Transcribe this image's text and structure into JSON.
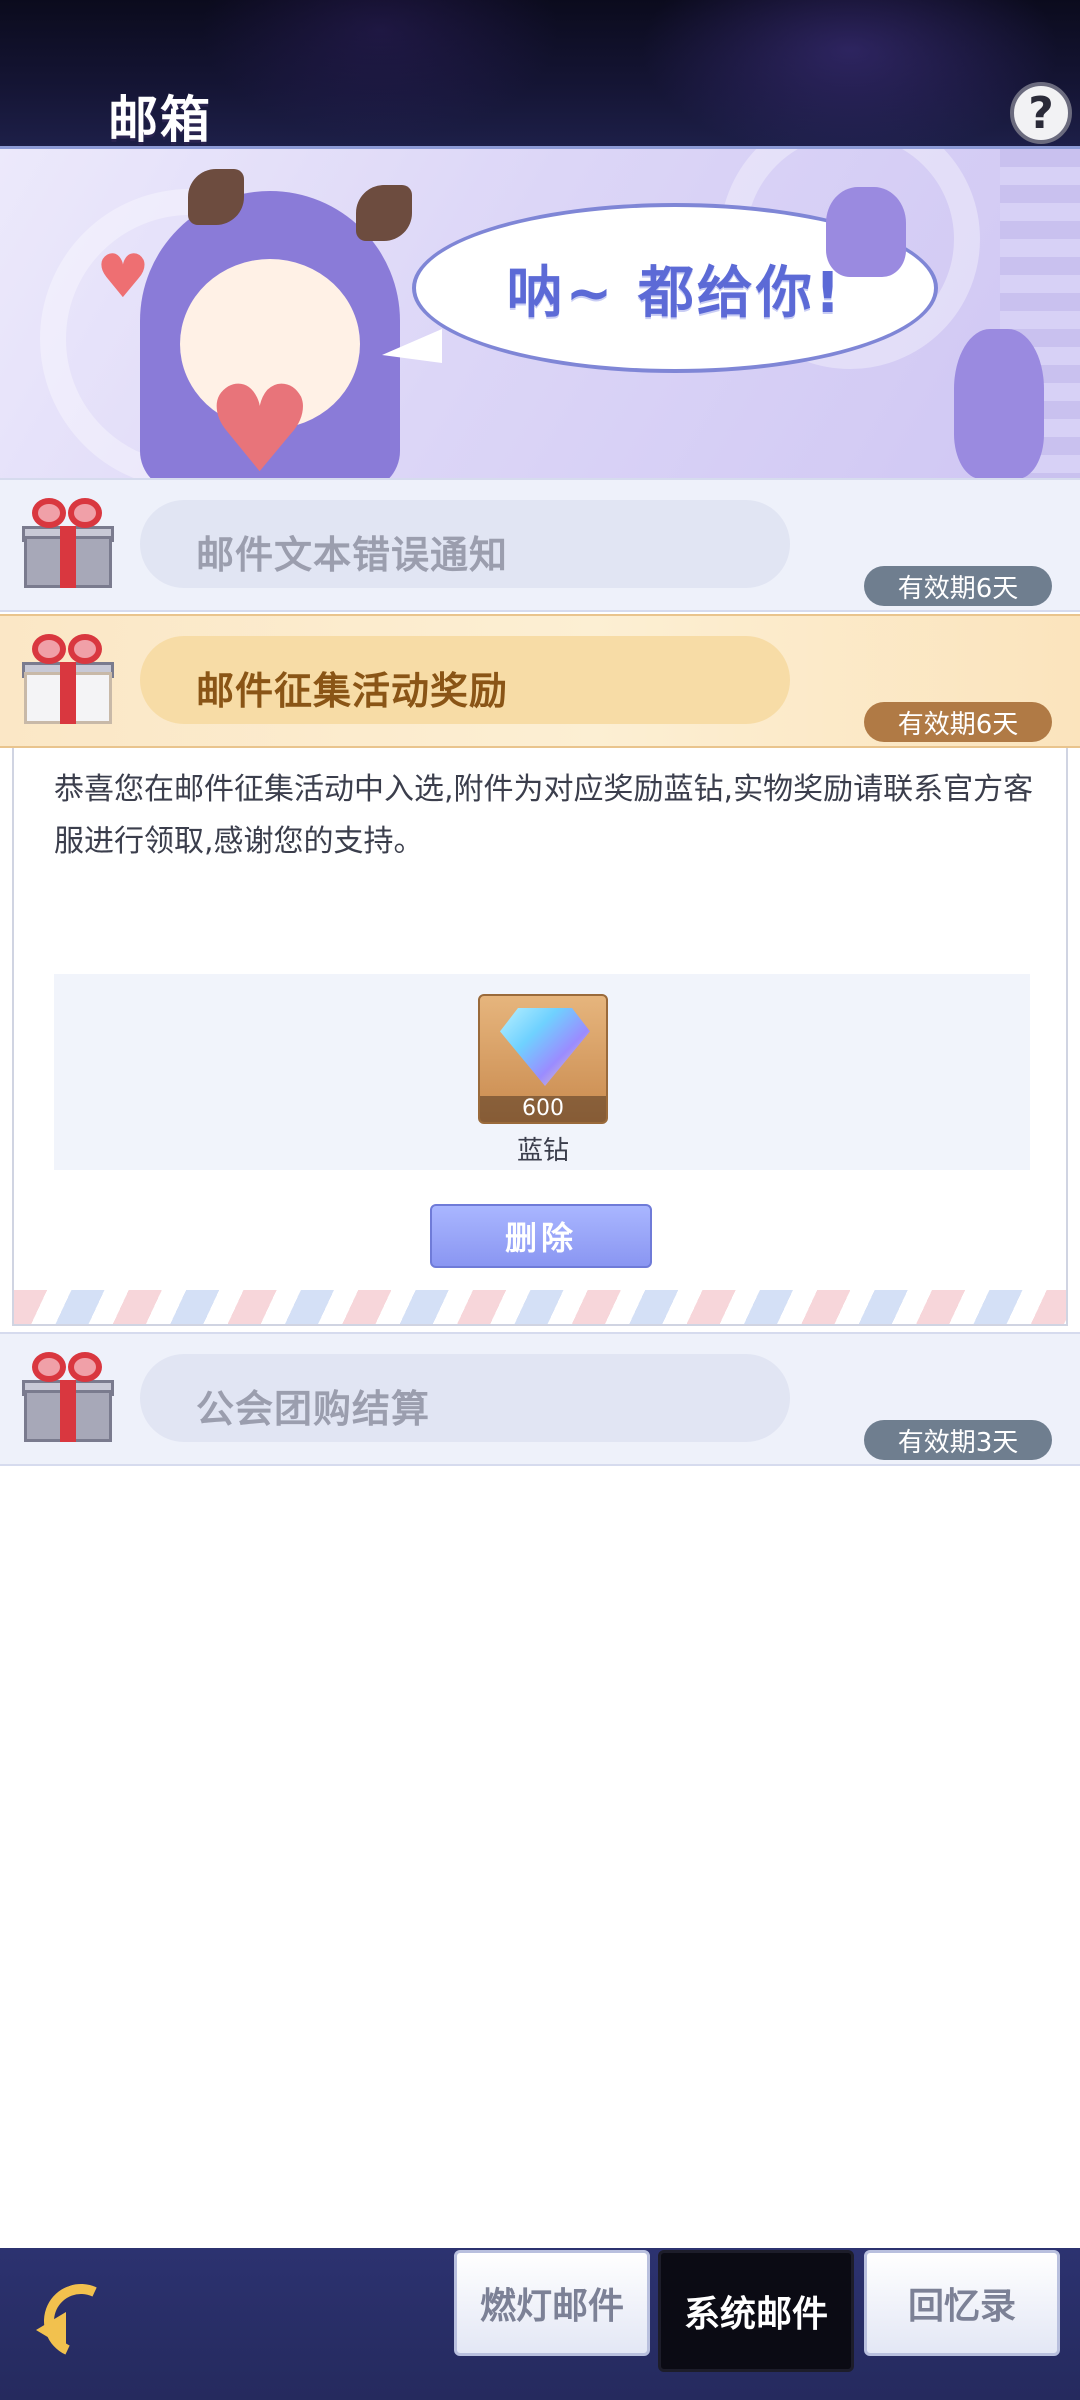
{
  "header": {
    "title": "邮箱",
    "help_label": "?"
  },
  "banner": {
    "speech": "呐~ 都给你!"
  },
  "mails": [
    {
      "title": "邮件文本错误通知",
      "validity": "有效期6天",
      "expanded": false
    },
    {
      "title": "邮件征集活动奖励",
      "validity": "有效期6天",
      "expanded": true
    },
    {
      "title": "公会团购结算",
      "validity": "有效期3天",
      "expanded": false
    }
  ],
  "expanded_mail": {
    "body": "恭喜您在邮件征集活动中入选,附件为对应奖励蓝钻,实物奖励请联系官方客服进行领取,感谢您的支持。",
    "attachment": {
      "icon": "blue-diamond-icon",
      "count": "600",
      "name": "蓝钻"
    },
    "delete_label": "删除"
  },
  "tabs": [
    {
      "label": "燃灯邮件",
      "selected": false
    },
    {
      "label": "系统邮件",
      "selected": true
    },
    {
      "label": "回忆录",
      "selected": false
    }
  ],
  "colors": {
    "header_bg": "#151535",
    "accent": "#8a96f2",
    "active_mail": "#fcefd3",
    "validity_badge": "#6f7e8f"
  }
}
